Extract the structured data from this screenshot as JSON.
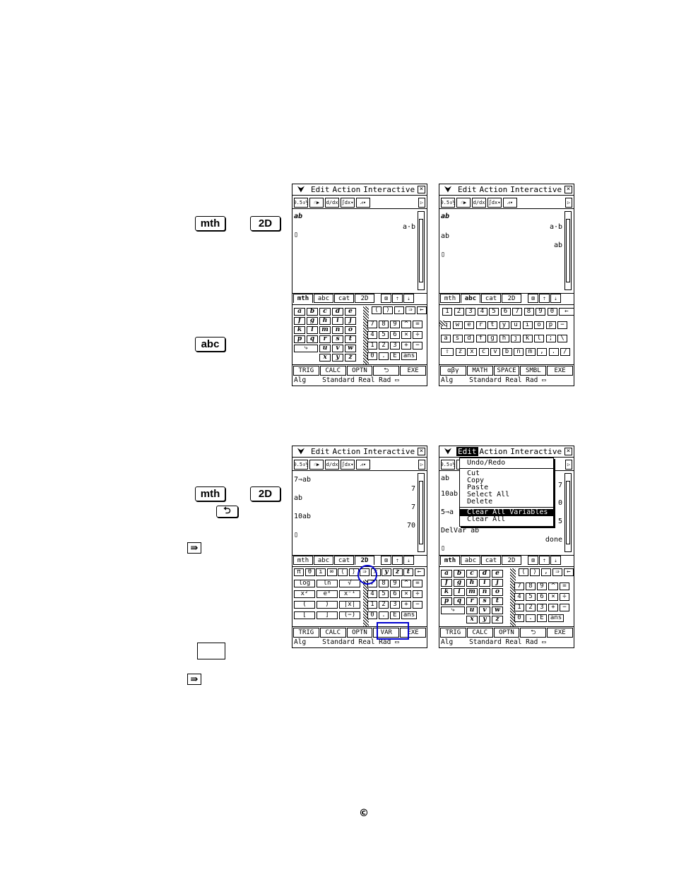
{
  "keys": {
    "mth": "mth",
    "twoD": "2D",
    "abc": "abc",
    "back_icon": "return-arrow-icon",
    "exe_icon": "double-right-arrow-icon"
  },
  "copyright": "©",
  "menu": {
    "items": [
      "Edit",
      "Action",
      "Interactive"
    ]
  },
  "tabs": [
    "mth",
    "abc",
    "cat",
    "2D"
  ],
  "status": {
    "left": "Alg",
    "mid": "Standard Real Rad"
  },
  "screen1": {
    "lines": [
      "ab",
      "a·b",
      "▯"
    ]
  },
  "screen2": {
    "lines": [
      "ab",
      "a·b",
      "ab",
      "ab",
      "▯"
    ]
  },
  "screen3": {
    "lines": [
      "7⇒ab",
      "7",
      "ab",
      "7",
      "10ab",
      "70",
      "▯"
    ]
  },
  "screen4": {
    "lines": [
      "ab",
      "7",
      "10ab",
      "0",
      "5⇒a",
      "5",
      "DelVar ab",
      "done",
      "▯"
    ]
  },
  "dropdown": [
    "Undo/Redo",
    "Cut",
    "Copy",
    "Paste",
    "Select All",
    "Delete",
    "Clear All Variables",
    "Clear All"
  ],
  "fkeys_mth": [
    "TRIG",
    "CALC",
    "OPTN",
    "⮌",
    "EXE"
  ],
  "fkeys_var": [
    "TRIG",
    "CALC",
    "OPTN",
    "VAR",
    "EXE"
  ],
  "fkeys_abc": [
    "αβγ",
    "MATH",
    "SPACE",
    "SMBL",
    "EXE"
  ],
  "var_letters": [
    "a",
    "b",
    "c",
    "d",
    "e",
    "f",
    "g",
    "h",
    "i",
    "j",
    "k",
    "l",
    "m",
    "n",
    "o",
    "p",
    "q",
    "r",
    "s",
    "t",
    "u",
    "v",
    "w",
    "x",
    "y",
    "z"
  ],
  "num_keys": [
    "7",
    "8",
    "9",
    "^",
    "=",
    "4",
    "5",
    "6",
    "×",
    "÷",
    "1",
    "2",
    "3",
    "+",
    "−",
    "0",
    ".",
    "E",
    "ans"
  ],
  "qwerty_row1": [
    "1",
    "2",
    "3",
    "4",
    "5",
    "6",
    "7",
    "8",
    "9",
    "0",
    "←"
  ],
  "qwerty_row2": [
    "q",
    "w",
    "e",
    "r",
    "t",
    "y",
    "u",
    "i",
    "o",
    "p",
    "−"
  ],
  "qwerty_row3": [
    "a",
    "s",
    "d",
    "f",
    "g",
    "h",
    "j",
    "k",
    "l",
    ";",
    "\\"
  ],
  "qwerty_row4": [
    "⇧",
    "z",
    "x",
    "c",
    "v",
    "b",
    "n",
    "m",
    ",",
    ".",
    "/"
  ],
  "math_keys": [
    "log",
    "ln",
    "√",
    "x²",
    "eˣ",
    "x⁻¹",
    "(",
    ")",
    "|x|",
    "[",
    "]",
    "(−)"
  ],
  "top_row": [
    "π",
    "θ",
    "i",
    "∞",
    "⟨",
    "⟩",
    "⇒",
    "x",
    "y",
    "z",
    "t",
    "←"
  ]
}
